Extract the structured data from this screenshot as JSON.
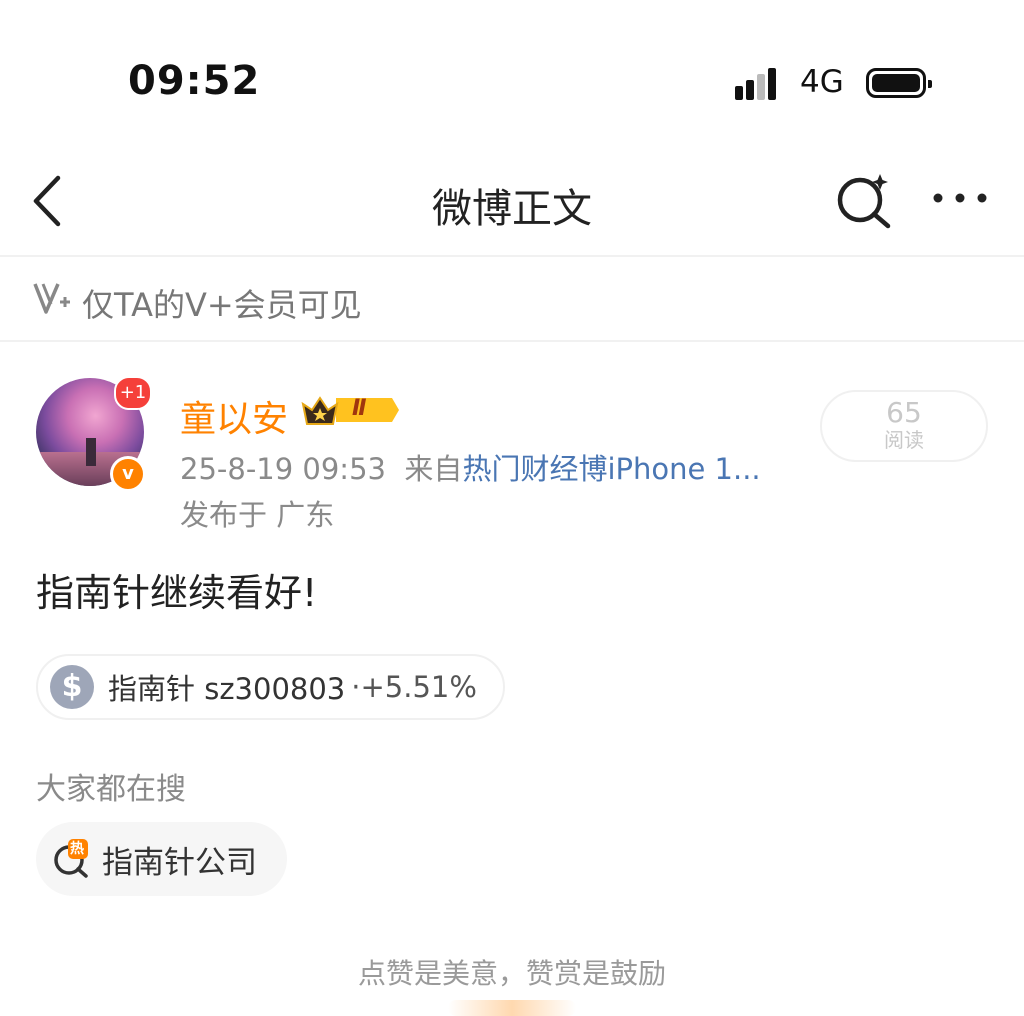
{
  "status_bar": {
    "time": "09:52",
    "network": "4G"
  },
  "nav": {
    "title": "微博正文"
  },
  "vip_notice": {
    "text": "仅TA的V+会员可见"
  },
  "author": {
    "name": "童以安",
    "new_count_badge": "+1",
    "level_badge": "Ⅱ",
    "timestamp": "25-8-19 09:53",
    "source_prefix": "来自",
    "source": "热门财经博iPhone 1...",
    "location": "发布于 广东",
    "verified_mark": "v"
  },
  "read": {
    "count": "65",
    "label": "阅读"
  },
  "post": {
    "text": "指南针继续看好!"
  },
  "stock": {
    "symbol": "$",
    "name": "指南针 sz300803",
    "change": "·+5.51%"
  },
  "search_section": {
    "title": "大家都在搜",
    "hot_icon_char": "热",
    "topic": "指南针公司"
  },
  "footer": {
    "tip": "点赞是美意，赞赏是鼓励"
  },
  "colors": {
    "brand_orange": "#ff8200",
    "link_blue": "#4a76b3",
    "badge_red": "#f5403a"
  }
}
